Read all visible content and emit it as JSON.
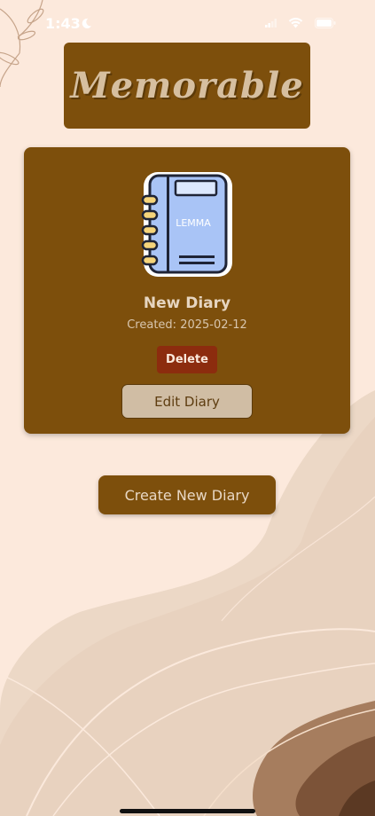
{
  "status_bar": {
    "time": "1:43",
    "icons": [
      "moon-icon",
      "cellular-signal-icon",
      "wifi-icon",
      "battery-icon"
    ]
  },
  "app": {
    "logo_text": "Memorable"
  },
  "diary_card": {
    "notebook_label": "LEMMA",
    "title": "New Diary",
    "created": "Created: 2025-02-12",
    "delete_label": "Delete",
    "edit_label": "Edit Diary"
  },
  "actions": {
    "create_label": "Create New Diary"
  },
  "colors": {
    "background": "#fce9dc",
    "primary_brown": "#7d4f0c",
    "delete_red": "#8c2c0e",
    "edit_button_bg": "#d0bda4",
    "logo_text": "#d6bfa0",
    "notebook_blue": "#a9c4f6"
  }
}
